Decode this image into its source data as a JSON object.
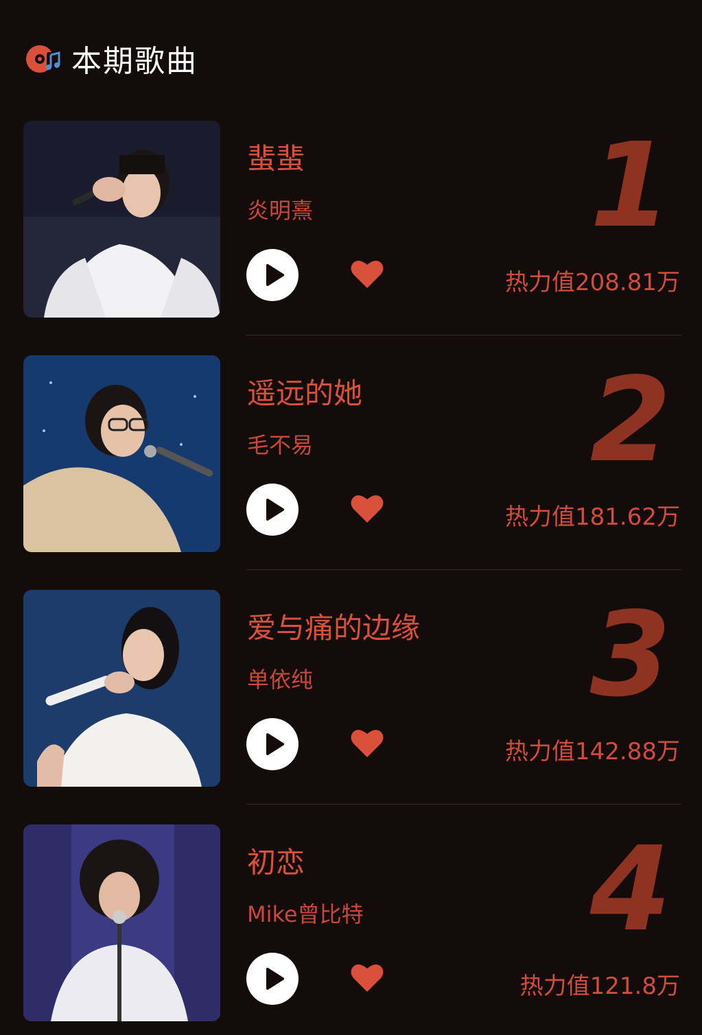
{
  "header": {
    "title": "本期歌曲",
    "icon": "music-disc-icon"
  },
  "colors": {
    "background": "#140b0b",
    "accent": "#d9503b",
    "rank": "#8e3222",
    "heart": "#d9503b"
  },
  "songs": [
    {
      "rank": "1",
      "title": "蜚蜚",
      "artist": "炎明熹",
      "heat": "热力值208.81万"
    },
    {
      "rank": "2",
      "title": "遥远的她",
      "artist": "毛不易",
      "heat": "热力值181.62万"
    },
    {
      "rank": "3",
      "title": "爱与痛的边缘",
      "artist": "单依纯",
      "heat": "热力值142.88万"
    },
    {
      "rank": "4",
      "title": "初恋",
      "artist": "Mike曾比特",
      "heat": "热力值121.8万"
    }
  ]
}
